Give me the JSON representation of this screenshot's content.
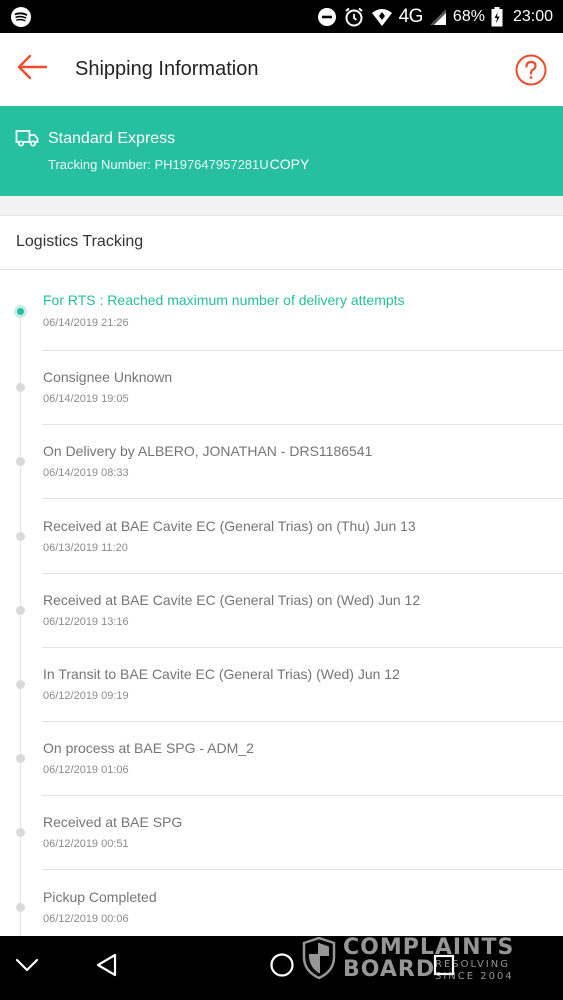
{
  "status_bar": {
    "battery": "68%",
    "network": "4G",
    "time": "23:00",
    "icons": [
      "spotify-icon",
      "dnd-icon",
      "alarm-icon",
      "wifi-icon",
      "signal-icon",
      "battery-icon"
    ]
  },
  "header": {
    "title": "Shipping Information",
    "back_icon": "arrow-left-icon",
    "help_icon": "question-icon",
    "accent_color": "#ee4d2d"
  },
  "shipping": {
    "method": "Standard Express",
    "tracking_label": "Tracking Number: PH197647957281U",
    "copy_label": "COPY",
    "banner_color": "#26bfa0"
  },
  "logistics": {
    "title": "Logistics Tracking",
    "events": [
      {
        "status": "For RTS : Reached maximum number of delivery attempts",
        "time": "06/14/2019 21:26"
      },
      {
        "status": "Consignee Unknown",
        "time": "06/14/2019 19:05"
      },
      {
        "status": "On Delivery by ALBERO, JONATHAN - DRS1186541",
        "time": "06/14/2019 08:33"
      },
      {
        "status": "Received at BAE Cavite EC (General Trias) on (Thu) Jun 13",
        "time": "06/13/2019 11:20"
      },
      {
        "status": "Received at BAE Cavite EC (General Trias) on (Wed) Jun 12",
        "time": "06/12/2019 13:16"
      },
      {
        "status": "In Transit to BAE Cavite EC (General Trias) (Wed) Jun 12",
        "time": "06/12/2019 09:19"
      },
      {
        "status": "On process at BAE SPG - ADM_2",
        "time": "06/12/2019 01:06"
      },
      {
        "status": "Received at BAE SPG",
        "time": "06/12/2019 00:51"
      },
      {
        "status": "Pickup Completed",
        "time": "06/12/2019 00:06"
      }
    ]
  },
  "watermark": {
    "line1": "COMPLAINTS",
    "line2": "BOARD",
    "tagline_1": "RESOLVING",
    "tagline_2": "SINCE 2004"
  }
}
